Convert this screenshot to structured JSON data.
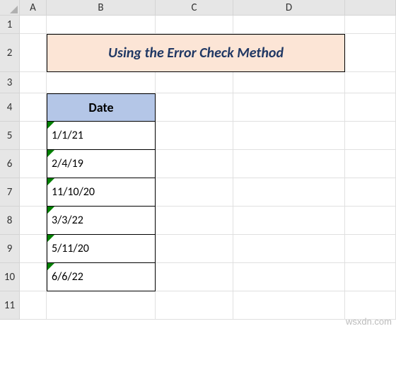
{
  "columns": [
    "A",
    "B",
    "C",
    "D"
  ],
  "rows": [
    "1",
    "2",
    "3",
    "4",
    "5",
    "6",
    "7",
    "8",
    "9",
    "10",
    "11"
  ],
  "title": "Using the Error Check Method",
  "table": {
    "header": "Date",
    "cells": [
      "1/1/21",
      "2/4/19",
      "11/10/20",
      "3/3/22",
      "5/11/20",
      "6/6/22"
    ]
  },
  "watermark": "wsxdn.com"
}
